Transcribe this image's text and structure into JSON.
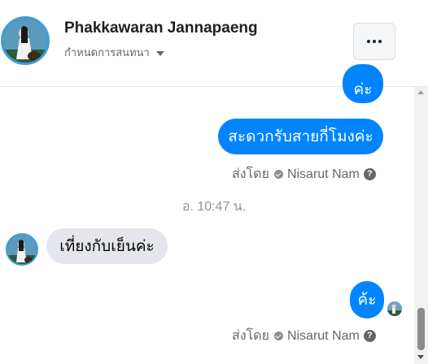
{
  "header": {
    "name": "Phakkawaran Jannapaeng",
    "subtitle": "กำหนดการสนทนา"
  },
  "messages": [
    {
      "direction": "out",
      "text": "ค่ะ",
      "partial": true
    },
    {
      "direction": "out",
      "text": "สะดวกรับสายกี่โมงค่ะ"
    },
    {
      "direction": "in",
      "text": "เที่ยงกับเย็นค่ะ"
    },
    {
      "direction": "out",
      "text": "ค้ะ"
    }
  ],
  "sent_by": {
    "prefix": "ส่งโดย",
    "name": "Nisarut Nam",
    "help": "?"
  },
  "timestamp": "อ. 10:47 น.",
  "colors": {
    "outgoing_bubble": "#0084ff",
    "incoming_bubble": "#e4e6eb"
  }
}
